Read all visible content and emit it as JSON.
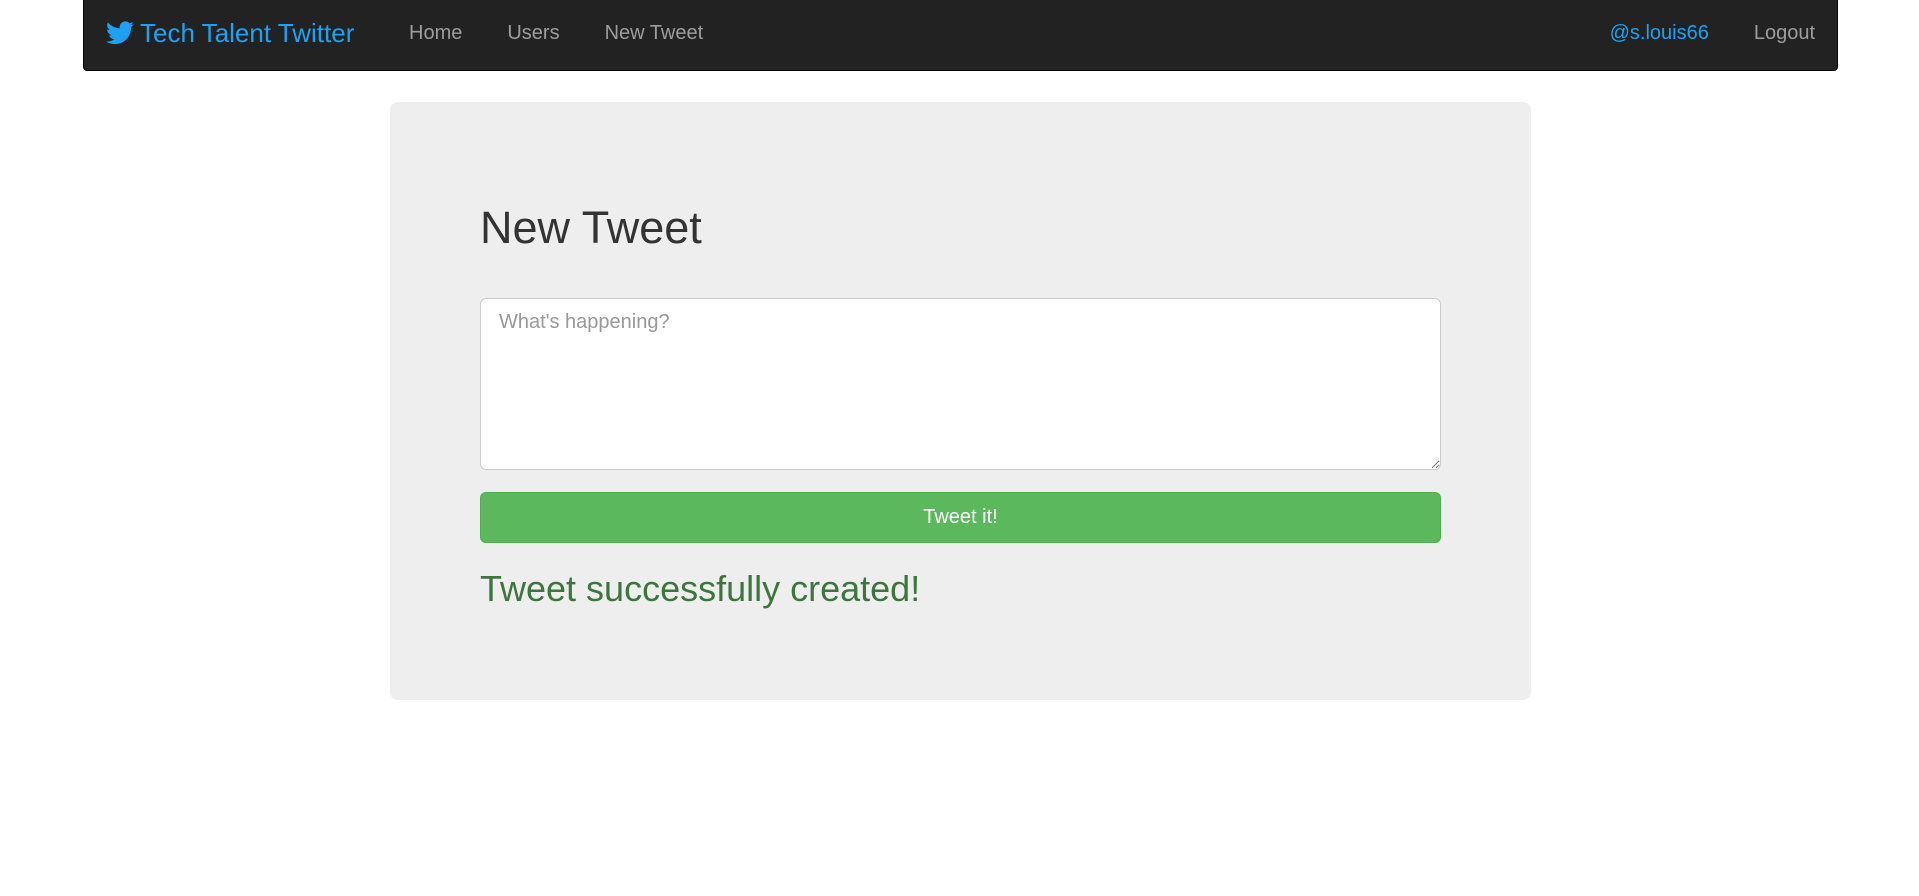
{
  "navbar": {
    "brand": "Tech Talent Twitter",
    "brand_icon": "twitter-bird-icon",
    "links": [
      {
        "label": "Home"
      },
      {
        "label": "Users"
      },
      {
        "label": "New Tweet"
      }
    ],
    "user_handle": "@s.louis66",
    "logout": "Logout"
  },
  "form": {
    "title": "New Tweet",
    "placeholder": "What's happening?",
    "value": "",
    "submit_label": "Tweet it!",
    "success_message": "Tweet successfully created!"
  },
  "colors": {
    "navbar_bg": "#222222",
    "brand_accent": "#1da1f2",
    "button_green": "#5cb85c",
    "success_text": "#3c763d",
    "panel_bg": "#eeeeee"
  }
}
